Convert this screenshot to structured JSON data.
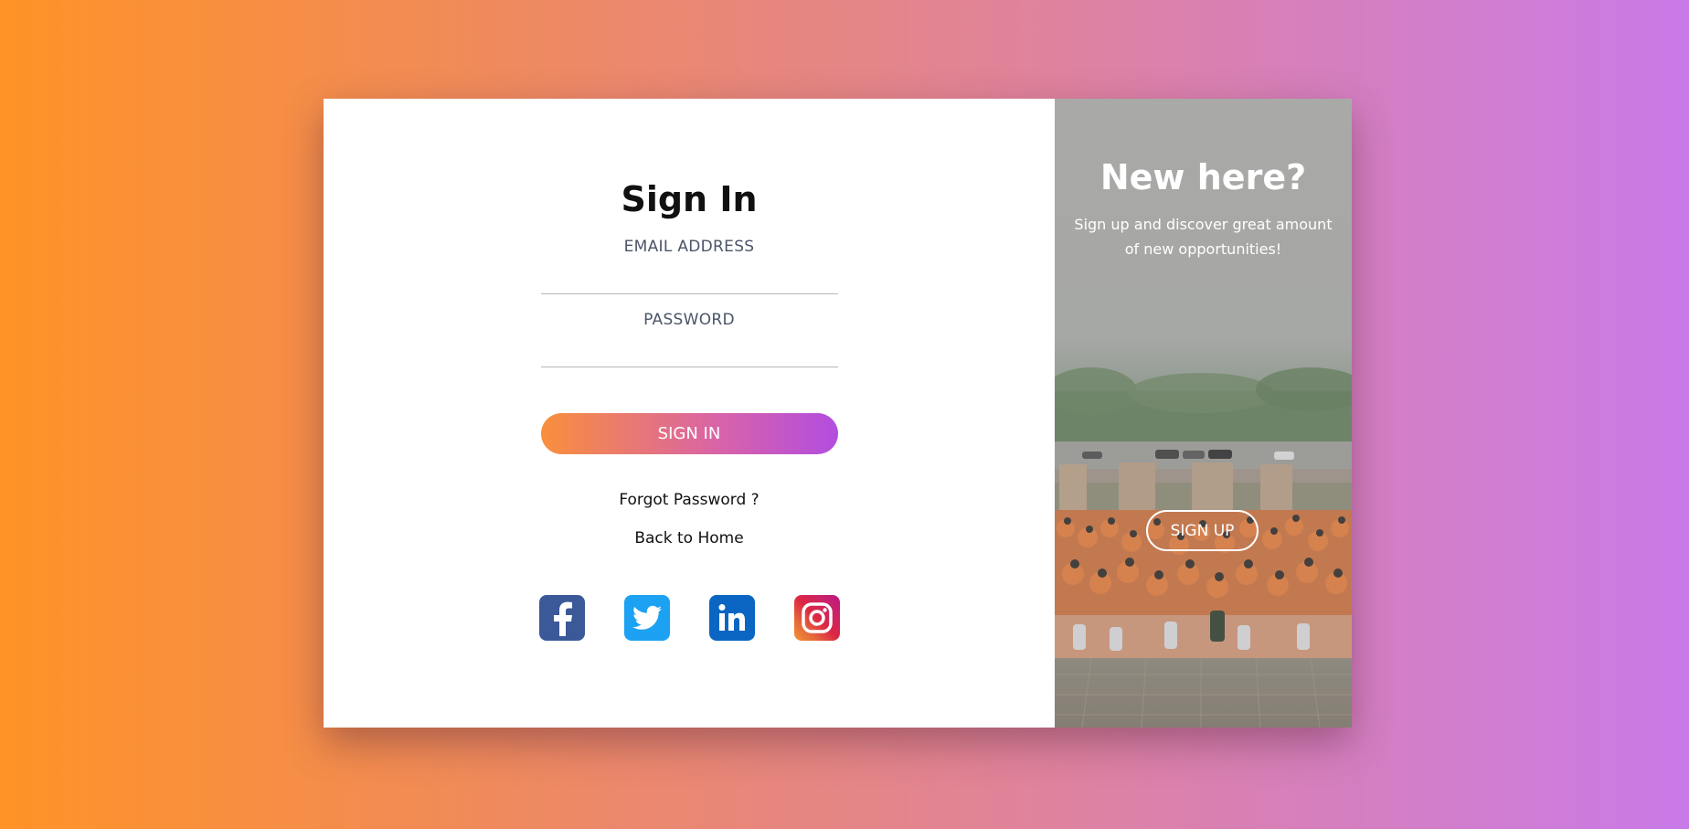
{
  "signin": {
    "title": "Sign In",
    "email_label": "EMAIL ADDRESS",
    "email_value": "",
    "password_label": "PASSWORD",
    "password_value": "",
    "button_label": "SIGN IN",
    "forgot_label": "Forgot Password ?",
    "home_label": "Back to Home"
  },
  "social": [
    {
      "icon": "facebook-icon",
      "color": "#3b5998"
    },
    {
      "icon": "twitter-icon",
      "color": "#1da1f2"
    },
    {
      "icon": "linkedin-icon",
      "color": "#0a66c2"
    },
    {
      "icon": "instagram-icon",
      "color": "#dc2743"
    }
  ],
  "signup_panel": {
    "title": "New here?",
    "description": "Sign up and discover great amount of new opportunities!",
    "button_label": "SIGN UP",
    "image": "group-photo"
  },
  "colors": {
    "background_start": "#ff9327",
    "background_end": "#c97ae8",
    "button_start": "#f98f3c",
    "button_end": "#b24de0"
  }
}
